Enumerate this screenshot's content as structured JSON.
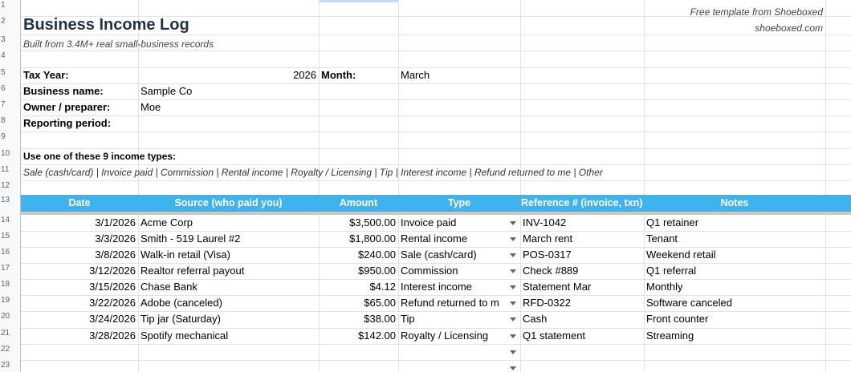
{
  "title": "Business Income Log",
  "subtitle": "Built from 3.4M+ real small-business records",
  "promo": {
    "line1": "Free template from Shoeboxed",
    "line2": "shoeboxed.com"
  },
  "row_numbers": [
    "1",
    "2",
    "3",
    "4",
    "5",
    "6",
    "7",
    "8",
    "9",
    "10",
    "11",
    "12",
    "13",
    "14",
    "15",
    "16",
    "17",
    "18",
    "19",
    "20",
    "21",
    "22",
    "23"
  ],
  "info": {
    "tax_year_label": "Tax Year:",
    "tax_year_value": "2026",
    "month_label": "Month:",
    "month_value": "March",
    "business_name_label": "Business name:",
    "business_name_value": "Sample Co",
    "owner_label": "Owner / preparer:",
    "owner_value": "Moe",
    "reporting_period_label": "Reporting period:"
  },
  "income_types": {
    "label": "Use one of these 9 income types:",
    "list": "Sale (cash/card) | Invoice paid | Commission | Rental income | Royalty / Licensing | Tip | Interest income | Refund returned to me | Other"
  },
  "table": {
    "headers": [
      "Date",
      "Source (who paid you)",
      "Amount",
      "Type",
      "Reference # (invoice, txn)",
      "Notes"
    ],
    "rows": [
      {
        "date": "3/1/2026",
        "source": "Acme Corp",
        "amount": "$3,500.00",
        "type": "Invoice paid",
        "ref": "INV-1042",
        "notes": "Q1 retainer"
      },
      {
        "date": "3/3/2026",
        "source": "Smith - 519 Laurel #2",
        "amount": "$1,800.00",
        "type": "Rental income",
        "ref": "March rent",
        "notes": "Tenant"
      },
      {
        "date": "3/8/2026",
        "source": "Walk-in retail (Visa)",
        "amount": "$240.00",
        "type": "Sale (cash/card)",
        "ref": "POS-0317",
        "notes": "Weekend retail"
      },
      {
        "date": "3/12/2026",
        "source": "Realtor referral payout",
        "amount": "$950.00",
        "type": "Commission",
        "ref": "Check #889",
        "notes": "Q1 referral"
      },
      {
        "date": "3/15/2026",
        "source": "Chase Bank",
        "amount": "$4.12",
        "type": "Interest income",
        "ref": "Statement Mar",
        "notes": "Monthly"
      },
      {
        "date": "3/22/2026",
        "source": "Adobe (canceled)",
        "amount": "$65.00",
        "type": "Refund returned to m",
        "ref": "RFD-0322",
        "notes": "Software canceled"
      },
      {
        "date": "3/24/2026",
        "source": "Tip jar (Saturday)",
        "amount": "$38.00",
        "type": "Tip",
        "ref": "Cash",
        "notes": "Front counter"
      },
      {
        "date": "3/28/2026",
        "source": "Spotify mechanical",
        "amount": "$142.00",
        "type": "Royalty / Licensing",
        "ref": "Q1 statement",
        "notes": "Streaming"
      }
    ]
  },
  "colors": {
    "header_bar": "#3fb3ee",
    "title": "#1f3347"
  }
}
